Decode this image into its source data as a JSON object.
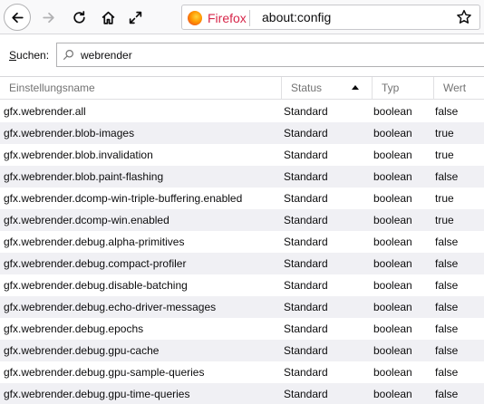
{
  "toolbar": {
    "brand": "Firefox",
    "url": "about:config"
  },
  "search": {
    "label_accesskey": "S",
    "label_rest": "uchen:",
    "value": "webrender"
  },
  "table": {
    "headers": {
      "name": "Einstellungsname",
      "status": "Status",
      "type": "Typ",
      "value": "Wert"
    },
    "sort": {
      "column": "status",
      "direction": "ascending"
    },
    "rows": [
      {
        "name": "gfx.webrender.all",
        "status": "Standard",
        "type": "boolean",
        "value": "false"
      },
      {
        "name": "gfx.webrender.blob-images",
        "status": "Standard",
        "type": "boolean",
        "value": "true"
      },
      {
        "name": "gfx.webrender.blob.invalidation",
        "status": "Standard",
        "type": "boolean",
        "value": "true"
      },
      {
        "name": "gfx.webrender.blob.paint-flashing",
        "status": "Standard",
        "type": "boolean",
        "value": "false"
      },
      {
        "name": "gfx.webrender.dcomp-win-triple-buffering.enabled",
        "status": "Standard",
        "type": "boolean",
        "value": "true"
      },
      {
        "name": "gfx.webrender.dcomp-win.enabled",
        "status": "Standard",
        "type": "boolean",
        "value": "true"
      },
      {
        "name": "gfx.webrender.debug.alpha-primitives",
        "status": "Standard",
        "type": "boolean",
        "value": "false"
      },
      {
        "name": "gfx.webrender.debug.compact-profiler",
        "status": "Standard",
        "type": "boolean",
        "value": "false"
      },
      {
        "name": "gfx.webrender.debug.disable-batching",
        "status": "Standard",
        "type": "boolean",
        "value": "false"
      },
      {
        "name": "gfx.webrender.debug.echo-driver-messages",
        "status": "Standard",
        "type": "boolean",
        "value": "false"
      },
      {
        "name": "gfx.webrender.debug.epochs",
        "status": "Standard",
        "type": "boolean",
        "value": "false"
      },
      {
        "name": "gfx.webrender.debug.gpu-cache",
        "status": "Standard",
        "type": "boolean",
        "value": "false"
      },
      {
        "name": "gfx.webrender.debug.gpu-sample-queries",
        "status": "Standard",
        "type": "boolean",
        "value": "false"
      },
      {
        "name": "gfx.webrender.debug.gpu-time-queries",
        "status": "Standard",
        "type": "boolean",
        "value": "false"
      }
    ]
  }
}
